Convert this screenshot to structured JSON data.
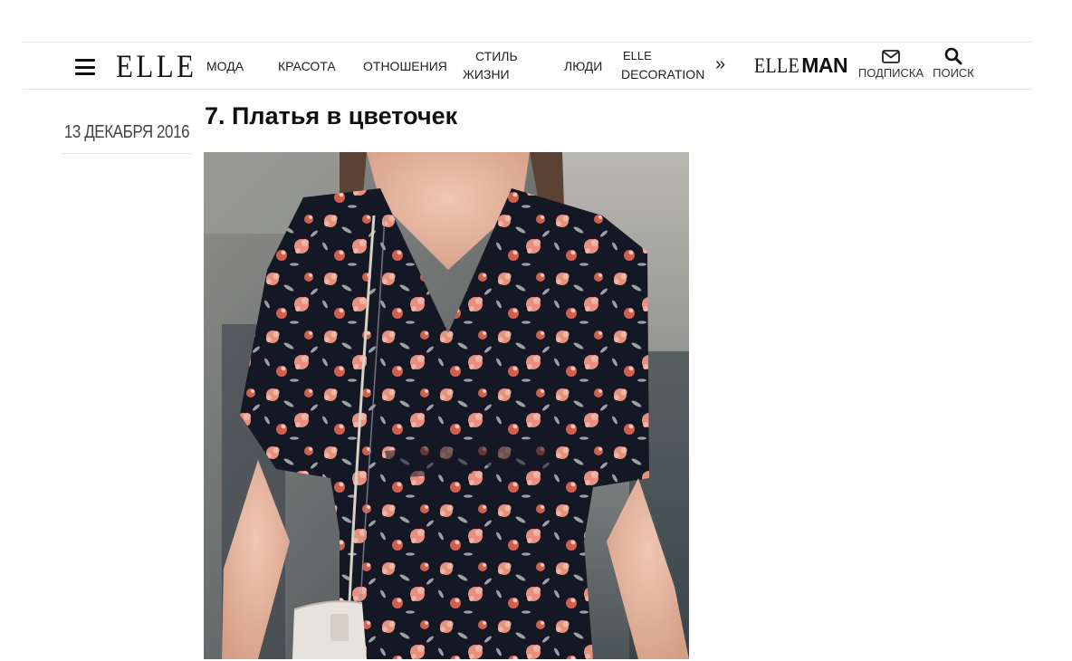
{
  "header": {
    "logo": "ELLE",
    "nav": [
      {
        "label": "МОДА"
      },
      {
        "label": "КРАСОТА"
      },
      {
        "label": "ОТНОШЕНИЯ"
      },
      {
        "line1": "СТИЛЬ",
        "line2": "ЖИЗНИ"
      },
      {
        "label": "ЛЮДИ"
      },
      {
        "line1": "ELLE",
        "line2": "DECORATION"
      }
    ],
    "more_glyph": "»",
    "elleman_a": "ELLE",
    "elleman_b": "MAN",
    "subscribe_label": "ПОДПИСКА",
    "search_label": "ПОИСК"
  },
  "article": {
    "date": "13 ДЕКАБРЯ 2016",
    "title": "7. Платья в цветочек"
  },
  "image": {
    "subject": "woman-in-floral-wrap-dress-with-white-crossbody-bag",
    "dress_color": "#141824",
    "flower_colors": [
      "#e8907e",
      "#f3b3a6",
      "#d05f4c",
      "#9aa2a6"
    ]
  }
}
